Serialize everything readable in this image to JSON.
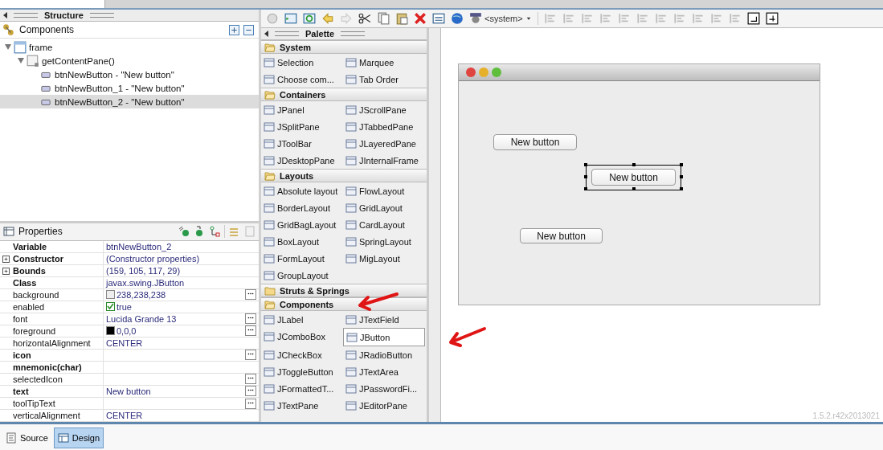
{
  "structure": {
    "title": "Structure",
    "components_label": "Components",
    "tree": [
      {
        "label": "frame",
        "kind": "frame",
        "expanded": true,
        "selected": false,
        "children": [
          {
            "label": "getContentPane()",
            "kind": "panel",
            "expanded": true,
            "selected": false,
            "children": [
              {
                "label": "btnNewButton - \"New button\"",
                "kind": "button",
                "selected": false
              },
              {
                "label": "btnNewButton_1 - \"New button\"",
                "kind": "button",
                "selected": false
              },
              {
                "label": "btnNewButton_2 - \"New button\"",
                "kind": "button",
                "selected": true
              }
            ]
          }
        ]
      }
    ]
  },
  "properties": {
    "title": "Properties",
    "rows": [
      {
        "name": "Variable",
        "value": "btnNewButton_2",
        "bold": true,
        "expandable": false,
        "kind": "text",
        "has_editor": false
      },
      {
        "name": "Constructor",
        "value": "(Constructor properties)",
        "bold": true,
        "expandable": true,
        "kind": "text",
        "has_editor": false
      },
      {
        "name": "Bounds",
        "value": "(159, 105, 117, 29)",
        "bold": true,
        "expandable": true,
        "kind": "text",
        "has_editor": false
      },
      {
        "name": "Class",
        "value": "javax.swing.JButton",
        "bold": true,
        "expandable": false,
        "kind": "text",
        "has_editor": false
      },
      {
        "name": "background",
        "value": "238,238,238",
        "bold": false,
        "expandable": false,
        "kind": "color",
        "color": "#eeeeee",
        "has_editor": true
      },
      {
        "name": "enabled",
        "value": "true",
        "bold": false,
        "expandable": false,
        "kind": "checkbox",
        "checked": true,
        "has_editor": false
      },
      {
        "name": "font",
        "value": "Lucida Grande 13",
        "bold": false,
        "expandable": false,
        "kind": "text",
        "has_editor": true
      },
      {
        "name": "foreground",
        "value": "0,0,0",
        "bold": false,
        "expandable": false,
        "kind": "color",
        "color": "#000000",
        "has_editor": true
      },
      {
        "name": "horizontalAlignment",
        "value": "CENTER",
        "bold": false,
        "expandable": false,
        "kind": "text",
        "has_editor": false
      },
      {
        "name": "icon",
        "bold": true,
        "expandable": false,
        "kind": "text",
        "has_editor": true
      },
      {
        "name": "mnemonic(char)",
        "bold": true,
        "expandable": false,
        "kind": "text",
        "has_editor": false
      },
      {
        "name": "selectedIcon",
        "bold": false,
        "expandable": false,
        "kind": "text",
        "has_editor": true
      },
      {
        "name": "text",
        "value": "New button",
        "bold": true,
        "expandable": false,
        "kind": "text",
        "has_editor": true
      },
      {
        "name": "toolTipText",
        "bold": false,
        "expandable": false,
        "kind": "text",
        "has_editor": true
      },
      {
        "name": "verticalAlignment",
        "value": "CENTER",
        "bold": false,
        "expandable": false,
        "kind": "text",
        "has_editor": false
      }
    ]
  },
  "toolbar": {
    "dropdown": "<system>"
  },
  "palette": {
    "title": "Palette",
    "groups": [
      {
        "label": "System",
        "expanded": true,
        "items": [
          {
            "label": "Selection",
            "selected": false
          },
          {
            "label": "Marquee",
            "selected": false
          },
          {
            "label": "Choose com...",
            "selected": false
          },
          {
            "label": "Tab Order",
            "selected": false
          }
        ]
      },
      {
        "label": "Containers",
        "expanded": true,
        "items": [
          {
            "label": "JPanel",
            "selected": false
          },
          {
            "label": "JScrollPane",
            "selected": false
          },
          {
            "label": "JSplitPane",
            "selected": false
          },
          {
            "label": "JTabbedPane",
            "selected": false
          },
          {
            "label": "JToolBar",
            "selected": false
          },
          {
            "label": "JLayeredPane",
            "selected": false
          },
          {
            "label": "JDesktopPane",
            "selected": false
          },
          {
            "label": "JInternalFrame",
            "selected": false
          }
        ]
      },
      {
        "label": "Layouts",
        "expanded": true,
        "items": [
          {
            "label": "Absolute layout",
            "selected": false
          },
          {
            "label": "FlowLayout",
            "selected": false
          },
          {
            "label": "BorderLayout",
            "selected": false
          },
          {
            "label": "GridLayout",
            "selected": false
          },
          {
            "label": "GridBagLayout",
            "selected": false
          },
          {
            "label": "CardLayout",
            "selected": false
          },
          {
            "label": "BoxLayout",
            "selected": false
          },
          {
            "label": "SpringLayout",
            "selected": false
          },
          {
            "label": "FormLayout",
            "selected": false
          },
          {
            "label": "MigLayout",
            "selected": false
          },
          {
            "label": "GroupLayout",
            "selected": false
          }
        ]
      },
      {
        "label": "Struts & Springs",
        "expanded": false
      },
      {
        "label": "Components",
        "expanded": true,
        "items": [
          {
            "label": "JLabel",
            "selected": false
          },
          {
            "label": "JTextField",
            "selected": false
          },
          {
            "label": "JComboBox",
            "selected": false
          },
          {
            "label": "JButton",
            "selected": true
          },
          {
            "label": "JCheckBox",
            "selected": false
          },
          {
            "label": "JRadioButton",
            "selected": false
          },
          {
            "label": "JToggleButton",
            "selected": false
          },
          {
            "label": "JTextArea",
            "selected": false
          },
          {
            "label": "JFormattedT...",
            "selected": false
          },
          {
            "label": "JPasswordFi...",
            "selected": false
          },
          {
            "label": "JTextPane",
            "selected": false
          },
          {
            "label": "JEditorPane",
            "selected": false
          }
        ]
      }
    ]
  },
  "canvas": {
    "buttons": [
      {
        "label": "New button",
        "selected": false
      },
      {
        "label": "New button",
        "selected": true
      },
      {
        "label": "New button",
        "selected": false
      }
    ],
    "version": "1.5.2.r42x2013021"
  },
  "bottom_tabs": [
    {
      "label": "Source",
      "selected": false
    },
    {
      "label": "Design",
      "selected": true
    }
  ]
}
